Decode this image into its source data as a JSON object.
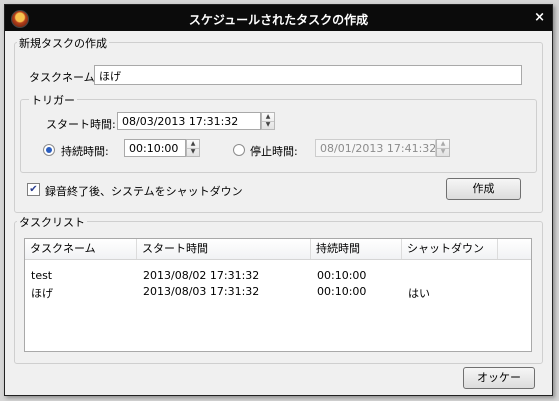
{
  "window": {
    "title": "スケジュールされたタスクの作成",
    "close_glyph": "×"
  },
  "create_group": {
    "label": "新規タスクの作成",
    "task_name_label": "タスクネーム:",
    "task_name_value": "ほげ"
  },
  "trigger": {
    "label": "トリガー",
    "start_label": "スタート時間:",
    "start_value": "08/03/2013 17:31:32",
    "duration_label": "持続時間:",
    "duration_value": "00:10:00",
    "duration_selected": true,
    "stop_label": "停止時間:",
    "stop_value": "08/01/2013 17:41:32"
  },
  "shutdown_checkbox": {
    "label": "録音終了後、システムをシャットダウン",
    "checked": true,
    "glyph": "✔"
  },
  "create_button": "作成",
  "task_list": {
    "label": "タスクリスト",
    "columns": [
      "タスクネーム",
      "スタート時間",
      "持続時間",
      "シャットダウン"
    ],
    "rows": [
      [
        "test",
        "2013/08/02 17:31:32",
        "00:10:00",
        ""
      ],
      [
        "ほげ",
        "2013/08/03 17:31:32",
        "00:10:00",
        "はい"
      ]
    ]
  },
  "ok_button": "オッケー",
  "spinner": {
    "up": "▲",
    "down": "▼"
  }
}
